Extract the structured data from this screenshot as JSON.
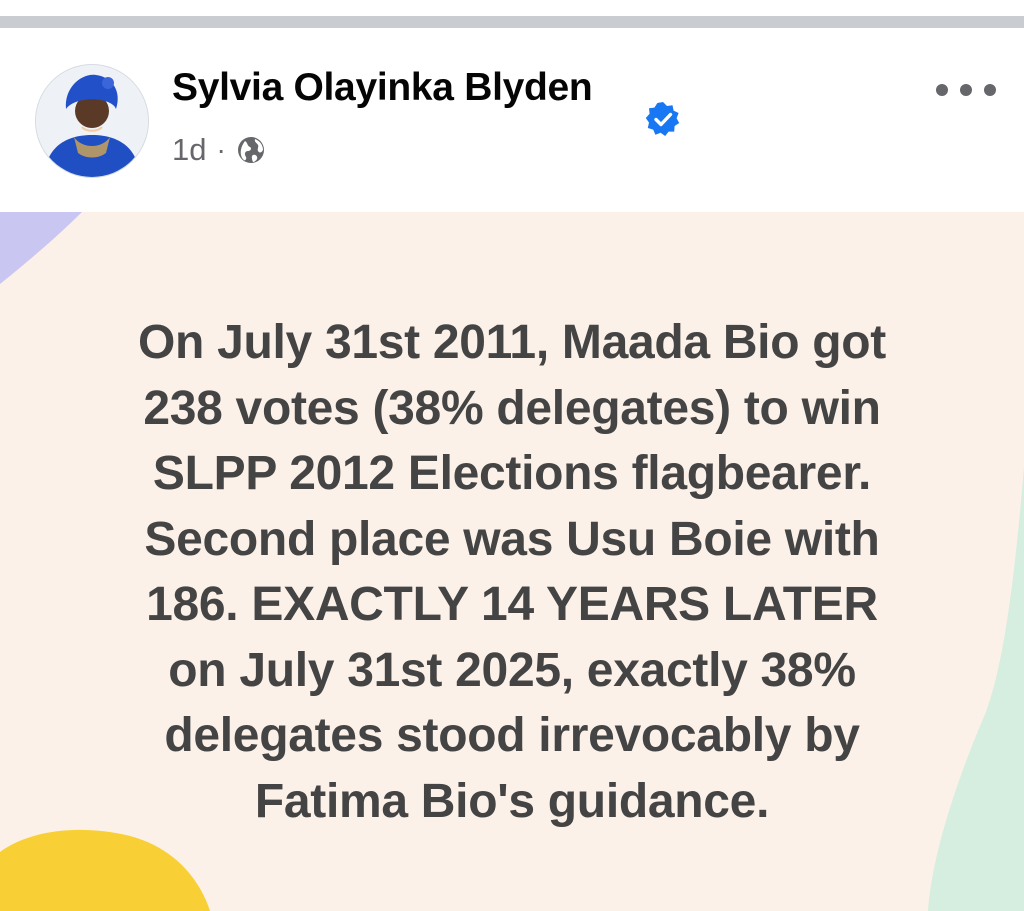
{
  "post": {
    "author_name": "Sylvia Olayinka Blyden",
    "timestamp": "1d",
    "separator": "·",
    "audience_icon": "globe-icon",
    "verified_icon": "verified-badge-icon",
    "more_icon": "more-options-icon",
    "body_lines": [
      "On July 31st 2011, Maada Bio got",
      "238 votes (38% delegates) to win",
      "SLPP 2012 Elections flagbearer.",
      "Second place was Usu Boie with",
      "186. EXACTLY 14 YEARS LATER",
      "on July 31st 2025, exactly 38%",
      "delegates stood irrevocably by",
      "Fatima Bio's guidance."
    ]
  },
  "colors": {
    "verified_blue": "#1877f2",
    "card_background": "#fbf1e8",
    "text_dark": "#444444",
    "meta_grey": "#65676b",
    "deco_purple": "#c9c7f1",
    "deco_mint": "#d5eedf",
    "deco_yellow": "#f8cf35"
  }
}
